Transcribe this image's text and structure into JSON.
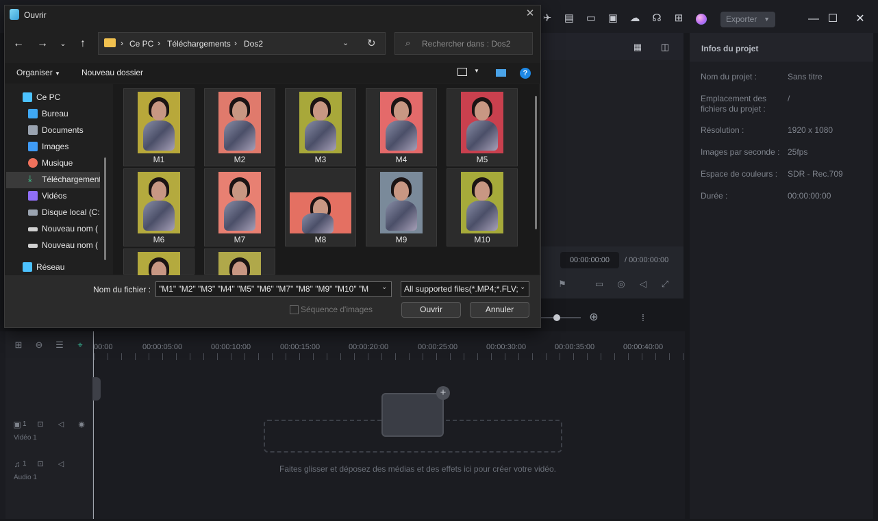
{
  "titlebar": {
    "export_label": "Exporter"
  },
  "player": {
    "current_time": "00:00:00:00",
    "total_time": "/ 00:00:00:00"
  },
  "project_info": {
    "title": "Infos du projet",
    "rows": [
      {
        "label": "Nom du projet :",
        "value": "Sans titre"
      },
      {
        "label": "Emplacement des fichiers du projet :",
        "value": "/"
      },
      {
        "label": "Résolution :",
        "value": "1920 x 1080"
      },
      {
        "label": "Images par seconde :",
        "value": "25fps"
      },
      {
        "label": "Espace de couleurs :",
        "value": "SDR - Rec.709"
      },
      {
        "label": "Durée :",
        "value": "00:00:00:00"
      }
    ]
  },
  "timeline": {
    "ruler": [
      "00:00",
      "00:00:05:00",
      "00:00:10:00",
      "00:00:15:00",
      "00:00:20:00",
      "00:00:25:00",
      "00:00:30:00",
      "00:00:35:00",
      "00:00:40:00"
    ],
    "tracks": [
      {
        "name": "Vidéo 1",
        "index": "1"
      },
      {
        "name": "Audio 1",
        "index": "1"
      }
    ],
    "drop_hint": "Faites glisser et déposez des médias et des effets ici pour créer votre vidéo."
  },
  "dialog": {
    "title": "Ouvrir",
    "breadcrumb": [
      "Ce PC",
      "Téléchargements",
      "Dos2"
    ],
    "search_placeholder": "Rechercher dans : Dos2",
    "organize_label": "Organiser",
    "new_folder_label": "Nouveau dossier",
    "nav_items": [
      {
        "label": "Ce PC",
        "icon": "computer-icon",
        "color": "#4cc2ff"
      },
      {
        "label": "Bureau",
        "icon": "desktop-icon",
        "color": "#3fa9f5"
      },
      {
        "label": "Documents",
        "icon": "documents-icon",
        "color": "#9aa3b0"
      },
      {
        "label": "Images",
        "icon": "images-icon",
        "color": "#3f9bf5"
      },
      {
        "label": "Musique",
        "icon": "music-icon",
        "color": "#f0725c"
      },
      {
        "label": "Téléchargement",
        "icon": "download-icon",
        "color": "#41c58c"
      },
      {
        "label": "Vidéos",
        "icon": "videos-icon",
        "color": "#8f6ef5"
      },
      {
        "label": "Disque local (C:)",
        "icon": "disk-icon",
        "color": "#9aa3b0"
      },
      {
        "label": "Nouveau nom (",
        "icon": "drive-icon",
        "color": "#d0d0d0"
      },
      {
        "label": "Nouveau nom (",
        "icon": "drive-icon",
        "color": "#d0d0d0"
      },
      {
        "label": "Réseau",
        "icon": "network-icon",
        "color": "#4cc2ff"
      }
    ],
    "files": [
      {
        "name": "M1",
        "bg": "#b8a83a"
      },
      {
        "name": "M2",
        "bg": "#e07a6c"
      },
      {
        "name": "M3",
        "bg": "#a8a83a"
      },
      {
        "name": "M4",
        "bg": "#e46a6a"
      },
      {
        "name": "M5",
        "bg": "#c9404e"
      },
      {
        "name": "M6",
        "bg": "#b4aa3e"
      },
      {
        "name": "M7",
        "bg": "#e88072"
      },
      {
        "name": "M8",
        "bg": "#e47062"
      },
      {
        "name": "M9",
        "bg": "#7a8a9a"
      },
      {
        "name": "M10",
        "bg": "#a6aa3a"
      },
      {
        "name": "",
        "bg": "#b4aa3e"
      },
      {
        "name": "",
        "bg": "#b0a84a"
      }
    ],
    "filename_label": "Nom du fichier :",
    "filename_value": "\"M1\" \"M2\" \"M3\" \"M4\" \"M5\" \"M6\" \"M7\" \"M8\" \"M9\" \"M10\" \"M",
    "filter_value": "All supported files(*.MP4;*.FLV;",
    "sequence_label": "Séquence d'images",
    "open_label": "Ouvrir",
    "cancel_label": "Annuler"
  }
}
